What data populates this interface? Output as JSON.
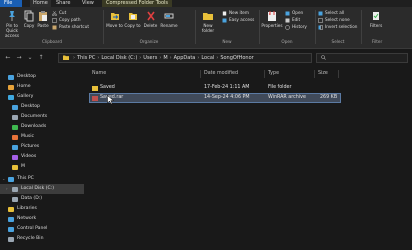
{
  "ribbon_tabs": [
    "File",
    "Home",
    "Share",
    "View",
    "Compressed Folder Tools"
  ],
  "ribbon": {
    "clipboard": {
      "pin": "Pin to Quick access",
      "copy": "Copy",
      "paste": "Paste",
      "cut": "Cut",
      "copy_path": "Copy path",
      "paste_shortcut": "Paste shortcut",
      "label": "Clipboard"
    },
    "organize": {
      "move_to": "Move to",
      "copy_to": "Copy to",
      "delete": "Delete",
      "rename": "Rename",
      "label": "Organize"
    },
    "new": {
      "new_folder": "New folder",
      "new_item": "New item",
      "easy_access": "Easy access",
      "label": "New"
    },
    "open": {
      "properties": "Properties",
      "open": "Open",
      "edit": "Edit",
      "history": "History",
      "label": "Open"
    },
    "select": {
      "select_all": "Select all",
      "select_none": "Select none",
      "invert": "Invert selection",
      "label": "Select"
    },
    "filter": {
      "filters": "Filters",
      "label": "Filter"
    }
  },
  "address": {
    "crumbs": [
      "This PC",
      "Local Disk (C:)",
      "Users",
      "M",
      "AppData",
      "Local",
      "SongOfHonor"
    ]
  },
  "sidebar": [
    {
      "label": "Desktop",
      "icon": "desktop-icon",
      "color": "#4aa3df"
    },
    {
      "label": "Home",
      "icon": "home-icon",
      "color": "#e8a33a"
    },
    {
      "label": "Gallery",
      "icon": "gallery-icon",
      "color": "#3fa9e0"
    },
    {
      "label": "Desktop",
      "icon": "desktop-icon",
      "color": "#4aa3df"
    },
    {
      "label": "Documents",
      "icon": "documents-icon",
      "color": "#9aa6b2"
    },
    {
      "label": "Downloads",
      "icon": "downloads-icon",
      "color": "#3fb950"
    },
    {
      "label": "Music",
      "icon": "music-icon",
      "color": "#e8733a"
    },
    {
      "label": "Pictures",
      "icon": "pictures-icon",
      "color": "#4aa3df"
    },
    {
      "label": "Videos",
      "icon": "videos-icon",
      "color": "#a560e8"
    },
    {
      "label": "M",
      "icon": "user-folder-icon",
      "color": "#e8c03a"
    },
    {
      "label": "This PC",
      "icon": "this-pc-icon",
      "color": "#4aa3df"
    },
    {
      "label": "Local Disk (C:)",
      "icon": "drive-icon",
      "color": "#9aa6b2"
    },
    {
      "label": "Data (D:)",
      "icon": "drive-icon",
      "color": "#9aa6b2"
    },
    {
      "label": "Libraries",
      "icon": "libraries-icon",
      "color": "#e8c03a"
    },
    {
      "label": "Network",
      "icon": "network-icon",
      "color": "#4aa3df"
    },
    {
      "label": "Control Panel",
      "icon": "control-panel-icon",
      "color": "#4aa3df"
    },
    {
      "label": "Recycle Bin",
      "icon": "recycle-bin-icon",
      "color": "#9aa6b2"
    }
  ],
  "columns": [
    "Name",
    "Date modified",
    "Type",
    "Size"
  ],
  "files": [
    {
      "name": "Saved",
      "date": "17-Feb-24 1:11 AM",
      "type": "File folder",
      "size": "",
      "icon": "folder-icon",
      "color": "#e8c03a"
    },
    {
      "name": "Saved.rar",
      "date": "14-Sep-24 4:06 PM",
      "type": "WinRAR archive",
      "size": "269 KB",
      "icon": "rar-archive-icon",
      "color": "#c0504d"
    }
  ],
  "colors": {
    "accent": "#1a5fb4",
    "selection": "#404a5a"
  }
}
